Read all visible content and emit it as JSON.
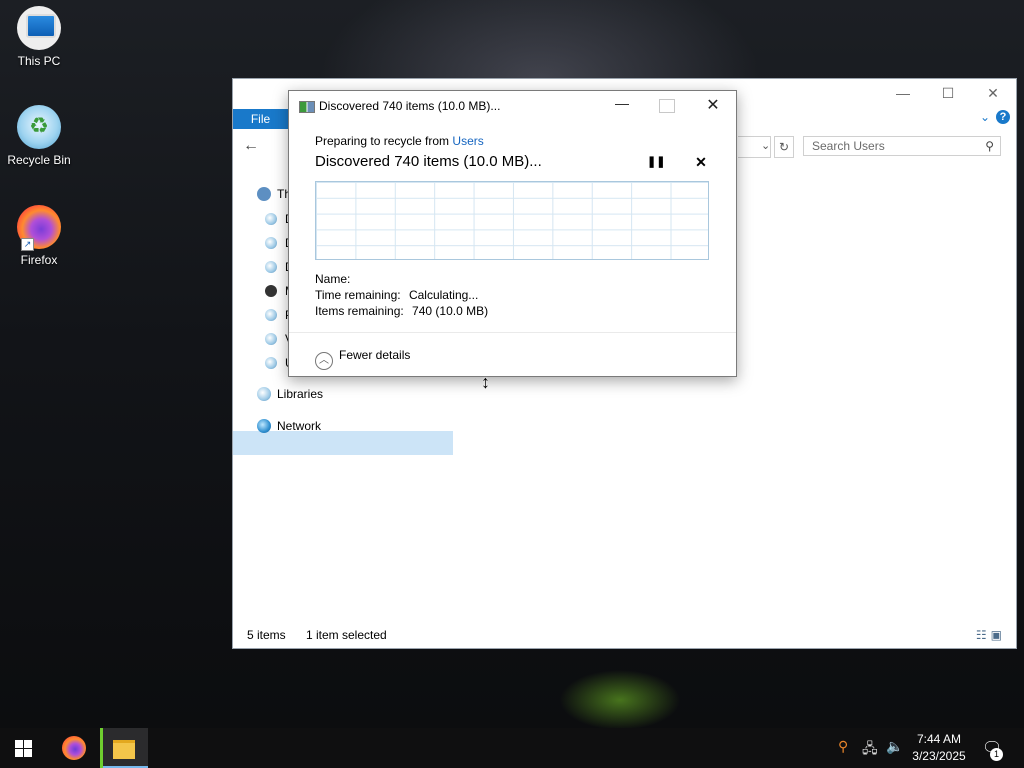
{
  "desktop": {
    "icons": [
      {
        "label": "This PC"
      },
      {
        "label": "Recycle Bin"
      },
      {
        "label": "Firefox"
      }
    ]
  },
  "explorer": {
    "ribbon": {
      "file_tab": "File",
      "help": "?"
    },
    "search": {
      "placeholder": "Search Users"
    },
    "nav": {
      "this_pc_label": "Th",
      "drive_letters": [
        "D",
        "D",
        "D",
        "M",
        "P",
        "V",
        "U"
      ],
      "libraries": "Libraries",
      "network": "Network"
    },
    "status": {
      "item_count": "5 items",
      "selection": "1 item selected"
    }
  },
  "dialog": {
    "title": "Discovered 740 items (10.0 MB)...",
    "preparing_prefix": "Preparing to recycle from",
    "preparing_link": "Users",
    "headline": "Discovered 740 items (10.0 MB)...",
    "name_label": "Name:",
    "name_value": "",
    "time_label": "Time remaining:",
    "time_value": "Calculating...",
    "items_label": "Items remaining:",
    "items_value": "740 (10.0 MB)",
    "details_toggle": "Fewer details"
  },
  "taskbar": {
    "time": "7:44 AM",
    "date": "3/23/2025",
    "notification_count": "1"
  },
  "colors": {
    "accent": "#1979ca",
    "link": "#1565c0",
    "selection": "#cce4f7"
  },
  "icons": [
    "this-pc-icon",
    "recycle-bin-icon",
    "firefox-icon",
    "search-icon",
    "refresh-icon",
    "pause-icon",
    "close-icon",
    "chevron-up-icon",
    "windows-start-icon",
    "network-icon",
    "volume-icon",
    "notification-icon"
  ]
}
